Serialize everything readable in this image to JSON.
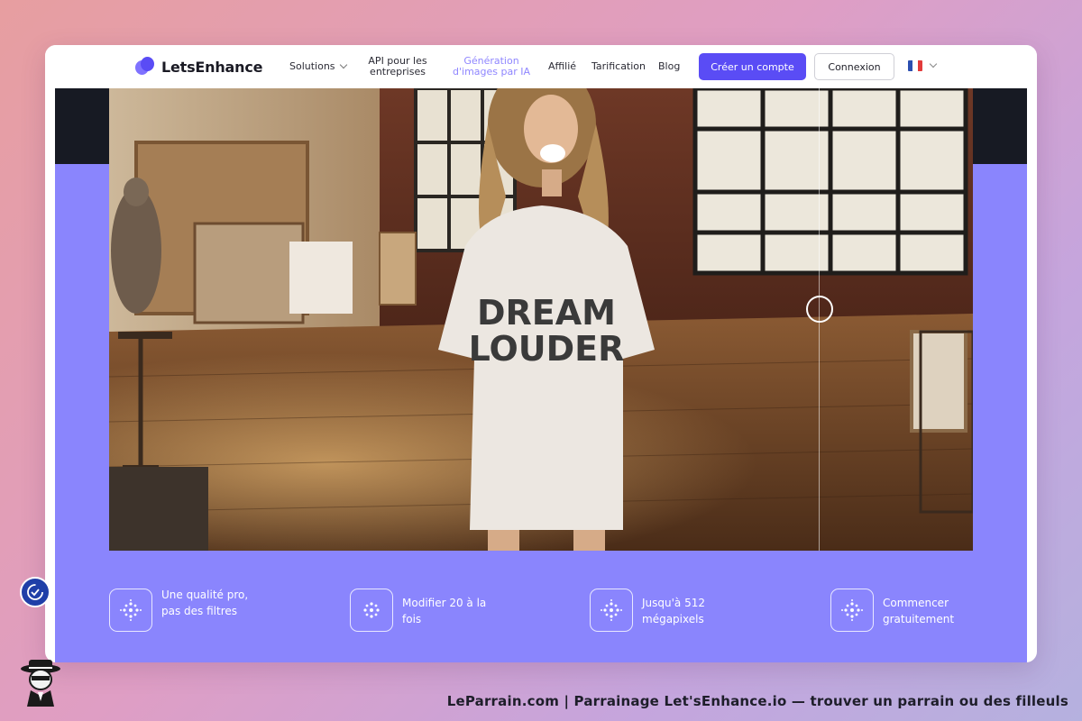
{
  "brand": {
    "name": "LetsEnhance",
    "logo_color": "#5a4cf5"
  },
  "nav": {
    "solutions": "Solutions",
    "api_line1": "API pour les",
    "api_line2": "entreprises",
    "gen_line1": "Génération",
    "gen_line2": "d'images par IA",
    "affiliate": "Affilié",
    "pricing": "Tarification",
    "blog": "Blog",
    "signup": "Créer un compte",
    "login": "Connexion",
    "language_flag": "fr-flag-icon"
  },
  "hero": {
    "shirt_line1": "DREAM",
    "shirt_line2": "LOUDER",
    "features": [
      {
        "icon": "dots-circle-icon",
        "text": "Une qualité pro, pas des filtres"
      },
      {
        "icon": "dots-circle-icon",
        "text": "Modifier 20 à la fois"
      },
      {
        "icon": "dots-circle-icon",
        "text": "Jusqu'à 512 mégapixels"
      },
      {
        "icon": "dots-circle-icon",
        "text": "Commencer gratuitement"
      }
    ]
  },
  "colors": {
    "accent": "#5a4cf5",
    "hero_bg": "#8a85fd",
    "dark_band": "#171a23"
  },
  "footer": {
    "caption": "LeParrain.com | Parrainage Let'sEnhance.io — trouver un parrain ou des filleuls"
  }
}
